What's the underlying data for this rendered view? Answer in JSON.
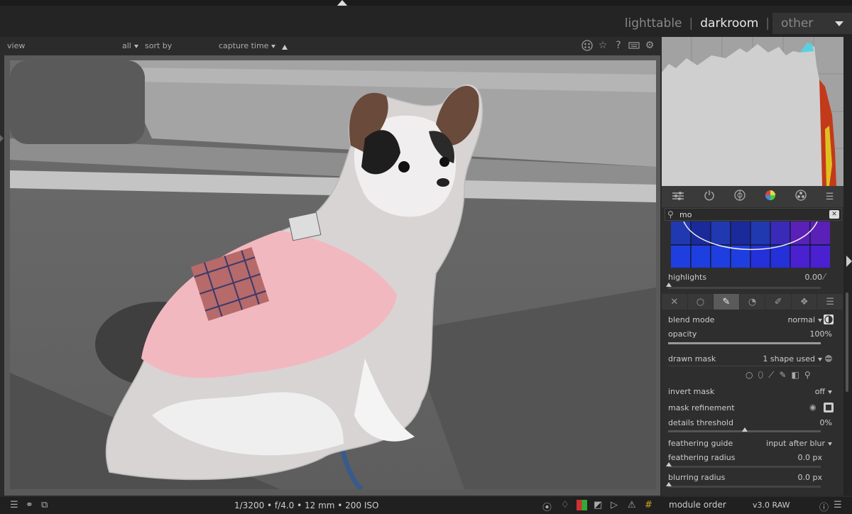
{
  "header": {
    "views": [
      {
        "label": "lighttable",
        "active": false
      },
      {
        "label": "darkroom",
        "active": true
      },
      {
        "label": "other",
        "active": false
      }
    ],
    "separator": "|"
  },
  "filterbar": {
    "view_label": "view",
    "all_label": "all",
    "sort_by_label": "sort by",
    "sort_value": "capture time"
  },
  "search": {
    "value": "mo"
  },
  "modules": {
    "highlights": {
      "label": "highlights",
      "value": "0.00"
    },
    "blend_mode": {
      "label": "blend mode",
      "value": "normal"
    },
    "opacity": {
      "label": "opacity",
      "value": "100%",
      "fill": 1.0
    },
    "drawn_mask": {
      "label": "drawn mask",
      "value": "1 shape used"
    },
    "invert_mask": {
      "label": "invert mask",
      "value": "off"
    },
    "mask_refinement": {
      "label": "mask refinement"
    },
    "details_threshold": {
      "label": "details threshold",
      "value": "0%",
      "fill": 0.5
    },
    "feathering_guide": {
      "label": "feathering guide",
      "value": "input after blur"
    },
    "feathering_radius": {
      "label": "feathering radius",
      "value": "0.0 px",
      "fill": 0
    },
    "blurring_radius": {
      "label": "blurring radius",
      "value": "0.0 px",
      "fill": 0
    }
  },
  "bottombar": {
    "exif": "1/3200 • f/4.0 • 12 mm • 200 ISO",
    "module_order_label": "module order",
    "module_order_value": "v3.0 RAW"
  },
  "colors": {
    "background": "#2b2b2b",
    "panel": "#2e2e2e",
    "histogram": "#9a9a9a",
    "accent_active_tab": "#5a5a5a"
  },
  "icons": [
    "grid-icon",
    "star-icon",
    "help-icon",
    "keyboard-icon",
    "gear-icon",
    "presets-icon",
    "power-icon",
    "active-modules-icon",
    "color-wheel-icon",
    "group-icon",
    "menu-icon",
    "search-icon",
    "clear-icon",
    "picker-icon",
    "mask-off-icon",
    "uniform-icon",
    "drawn-icon",
    "parametric-icon",
    "drawn-parametric-icon",
    "raster-icon"
  ]
}
